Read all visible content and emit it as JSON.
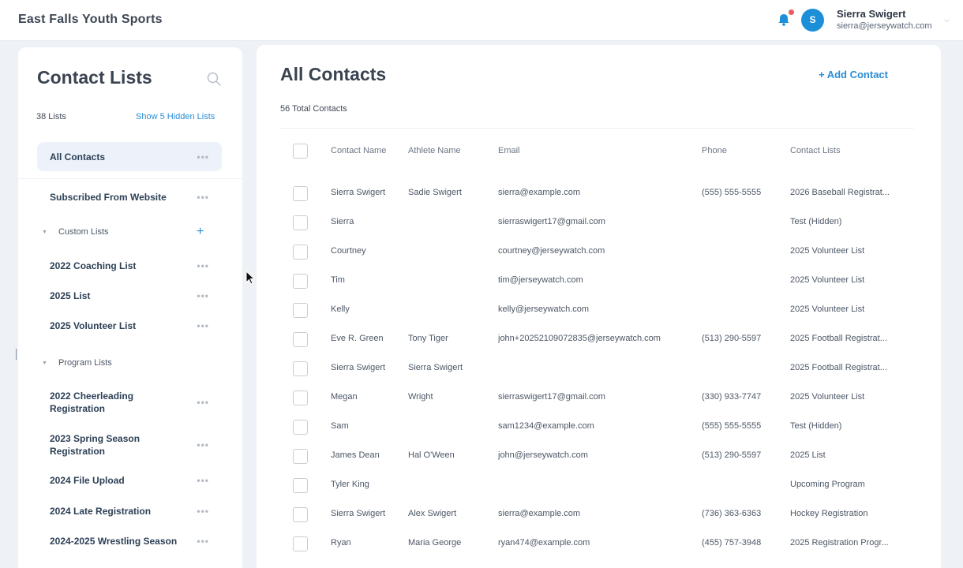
{
  "header": {
    "org_name": "East Falls Youth Sports",
    "user": {
      "initial": "S",
      "name": "Sierra Swigert",
      "email": "sierra@jerseywatch.com"
    },
    "notification_color": "#ef5a5a",
    "accent": "#2a8dd4"
  },
  "sidebar": {
    "title": "Contact Lists",
    "list_count": "38 Lists",
    "show_hidden": "Show 5 Hidden Lists",
    "top_items": [
      {
        "label": "All Contacts",
        "active": true
      },
      {
        "label": "Subscribed From Website"
      }
    ],
    "groups": [
      {
        "label": "Custom Lists",
        "items": [
          {
            "label": "2022 Coaching List"
          },
          {
            "label": "2025 List"
          },
          {
            "label": "2025 Volunteer List"
          }
        ]
      },
      {
        "label": "Program Lists",
        "items": [
          {
            "label": "2022 Cheerleading Registration"
          },
          {
            "label": "2023 Spring Season Registration"
          },
          {
            "label": "2024 File Upload"
          },
          {
            "label": "2024 Late Registration"
          },
          {
            "label": "2024-2025 Wrestling Season"
          }
        ]
      }
    ],
    "more_glyph": "•••",
    "add_glyph": "+"
  },
  "main": {
    "title": "All Contacts",
    "add_button": "+ Add Contact",
    "total": "56 Total Contacts",
    "columns": [
      "Contact Name",
      "Athlete Name",
      "Email",
      "Phone",
      "Contact Lists"
    ],
    "rows": [
      [
        "Sierra Swigert",
        "Sadie Swigert",
        "sierra@example.com",
        "(555) 555-5555",
        "2026 Baseball Registrat..."
      ],
      [
        "Sierra",
        "",
        "sierraswigert17@gmail.com",
        "",
        "Test (Hidden)"
      ],
      [
        "Courtney",
        "",
        "courtney@jerseywatch.com",
        "",
        "2025 Volunteer List"
      ],
      [
        "Tim",
        "",
        "tim@jerseywatch.com",
        "",
        "2025 Volunteer List"
      ],
      [
        "Kelly",
        "",
        "kelly@jerseywatch.com",
        "",
        "2025 Volunteer List"
      ],
      [
        "Eve R. Green",
        "Tony Tiger",
        "john+20252109072835@jerseywatch.com",
        "(513) 290-5597",
        "2025 Football Registrat..."
      ],
      [
        "Sierra Swigert",
        "Sierra Swigert",
        "",
        "",
        "2025 Football Registrat..."
      ],
      [
        "Megan",
        "Wright",
        "sierraswigert17@gmail.com",
        "(330) 933-7747",
        "2025 Volunteer List"
      ],
      [
        "Sam",
        "",
        "sam1234@example.com",
        "(555) 555-5555",
        "Test (Hidden)"
      ],
      [
        "James Dean",
        "Hal O'Ween",
        "john@jerseywatch.com",
        "(513) 290-5597",
        "2025 List"
      ],
      [
        "Tyler King",
        "",
        "",
        "",
        "Upcoming Program"
      ],
      [
        "Sierra Swigert",
        "Alex Swigert",
        "sierra@example.com",
        "(736) 363-6363",
        "Hockey Registration"
      ],
      [
        "Ryan",
        "Maria George",
        "ryan474@example.com",
        "(455) 757-3948",
        "2025 Registration Progr..."
      ]
    ]
  }
}
